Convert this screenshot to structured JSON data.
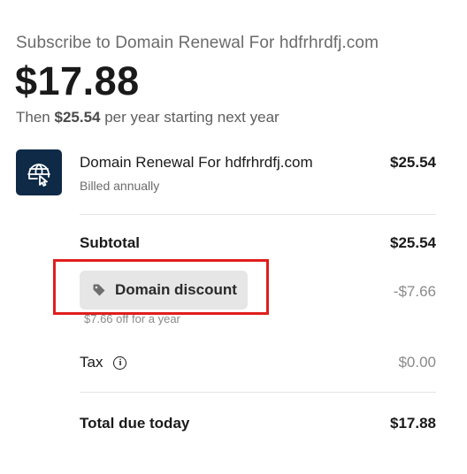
{
  "header": {
    "title": "Subscribe to Domain Renewal For hdfrhrdfj.com",
    "price": "$17.88",
    "then_prefix": "Then",
    "then_amount": "$25.54",
    "then_suffix": "per year starting next year"
  },
  "line_item": {
    "icon": "globe-cursor-icon",
    "name": "Domain Renewal For hdfrhrdfj.com",
    "billing": "Billed annually",
    "price": "$25.54"
  },
  "summary": {
    "subtotal_label": "Subtotal",
    "subtotal_value": "$25.54",
    "discount_label": "Domain discount",
    "discount_icon": "tag-icon",
    "discount_value": "-$7.66",
    "discount_note": "$7.66 off for a year",
    "tax_label": "Tax",
    "tax_info_icon": "info-icon",
    "tax_value": "$0.00",
    "total_label": "Total due today",
    "total_value": "$17.88"
  },
  "colors": {
    "icon_bg": "#0e2a47",
    "chip_bg": "#e6e6e6",
    "highlight": "#e01e1e"
  }
}
